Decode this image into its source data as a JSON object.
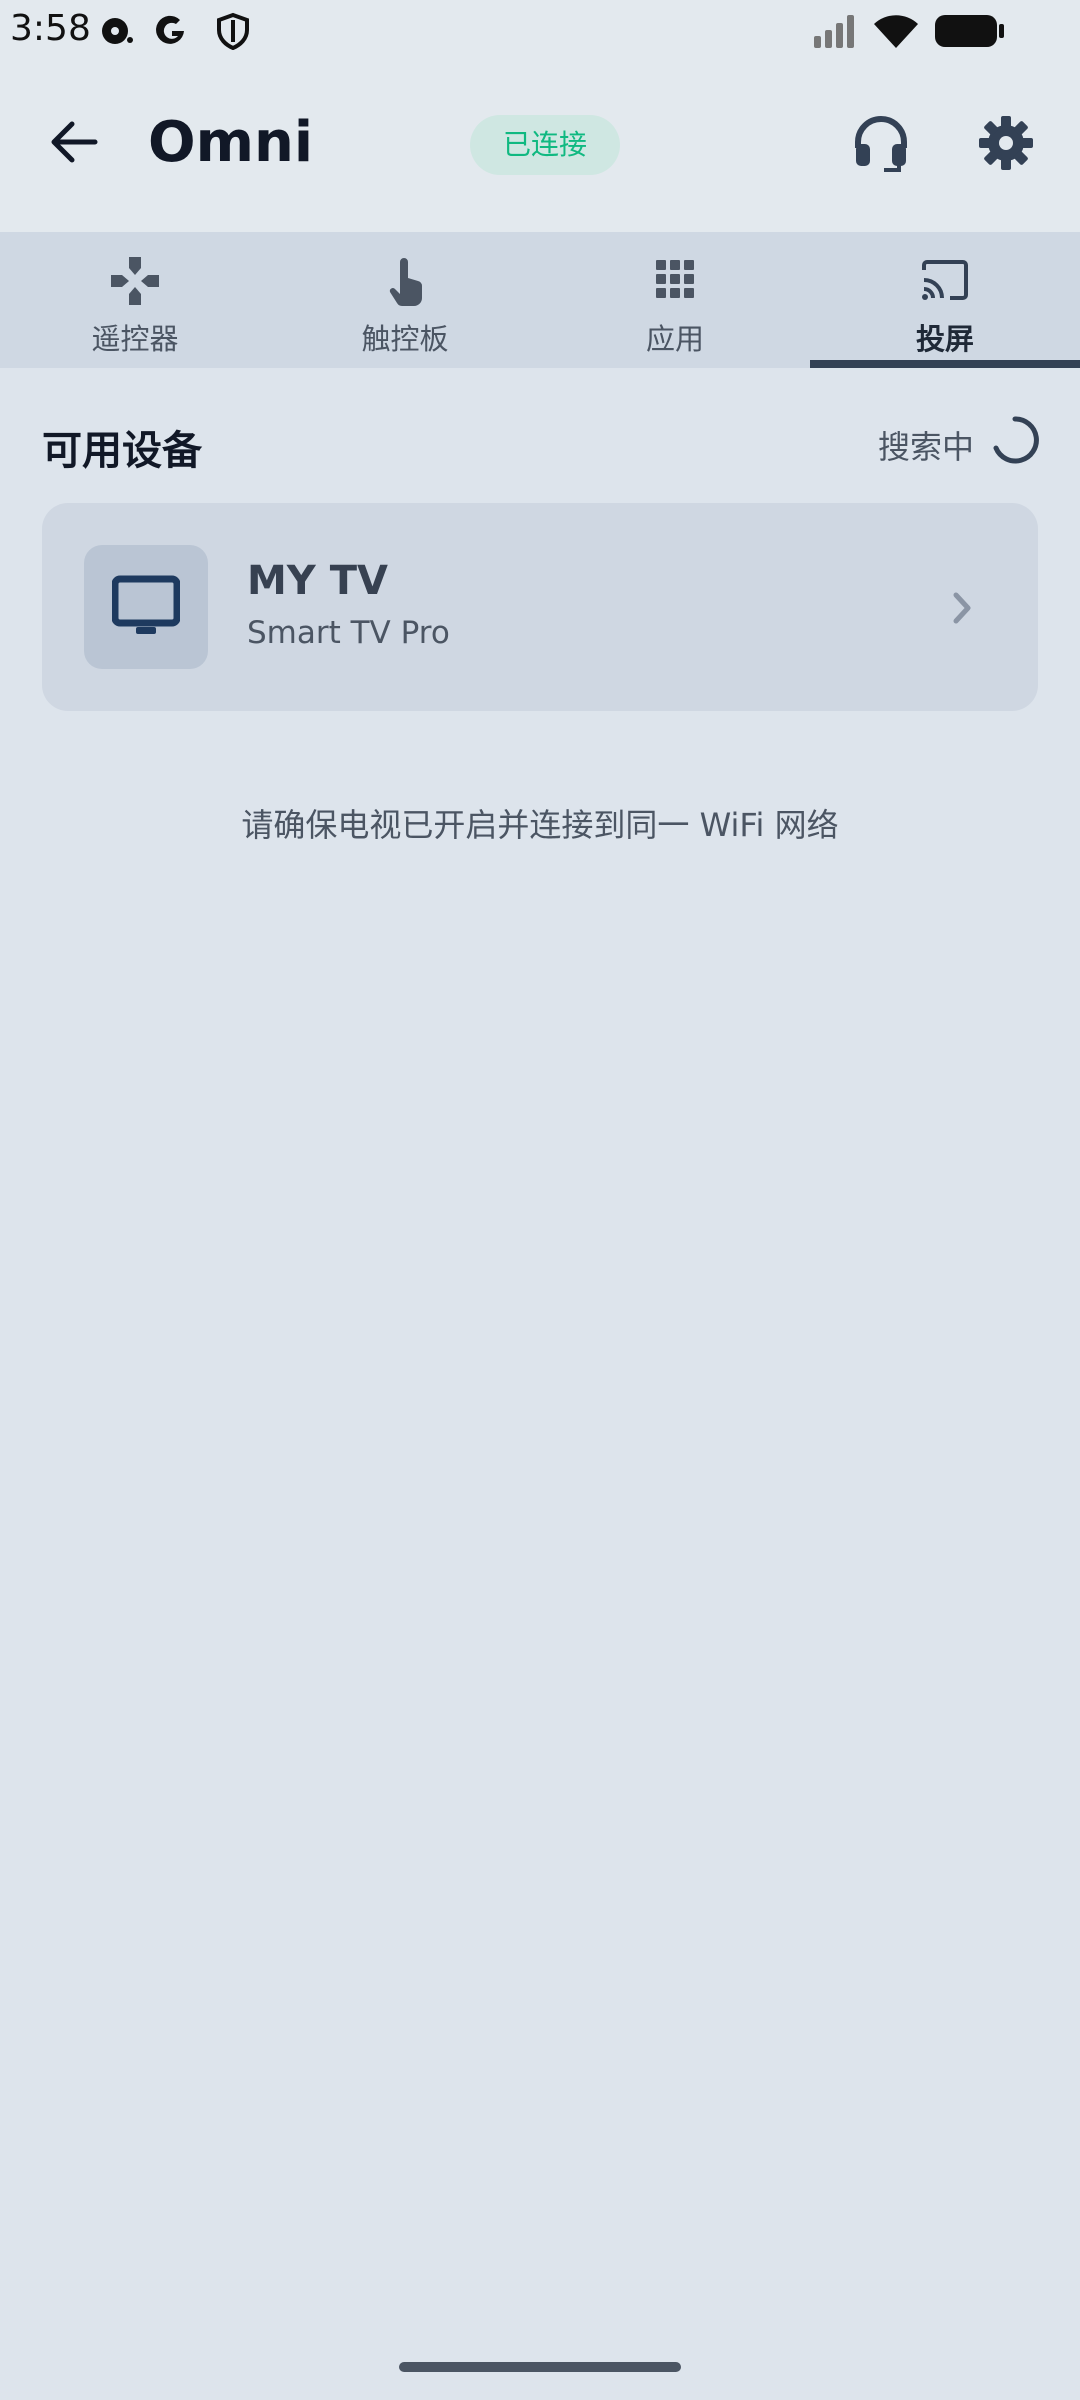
{
  "status_bar": {
    "time": "3:58",
    "icons": [
      "media-icon",
      "google-icon",
      "shield-icon",
      "signal-icon",
      "wifi-icon",
      "battery-icon"
    ]
  },
  "app_bar": {
    "title": "Omni",
    "connection_status": "已连接",
    "icons": [
      "back-arrow-icon",
      "headset-icon",
      "gear-icon"
    ]
  },
  "tabs": [
    {
      "label": "遥控器",
      "icon": "gamepad-icon"
    },
    {
      "label": "触控板",
      "icon": "touch-icon"
    },
    {
      "label": "应用",
      "icon": "grid-icon"
    },
    {
      "label": "投屏",
      "icon": "cast-icon"
    }
  ],
  "active_tab": "投屏",
  "content": {
    "section_title": "可用设备",
    "search_status": "搜索中",
    "devices": [
      {
        "name": "MY TV",
        "model": "Smart TV Pro",
        "icon": "tv-icon"
      }
    ],
    "hint": "请确保电视已开启并连接到同一 WiFi 网络"
  },
  "colors": {
    "accent": "#334155",
    "connected_text": "#10b981",
    "connected_bg": "#cfe7e2",
    "background": "#dde4ec"
  }
}
